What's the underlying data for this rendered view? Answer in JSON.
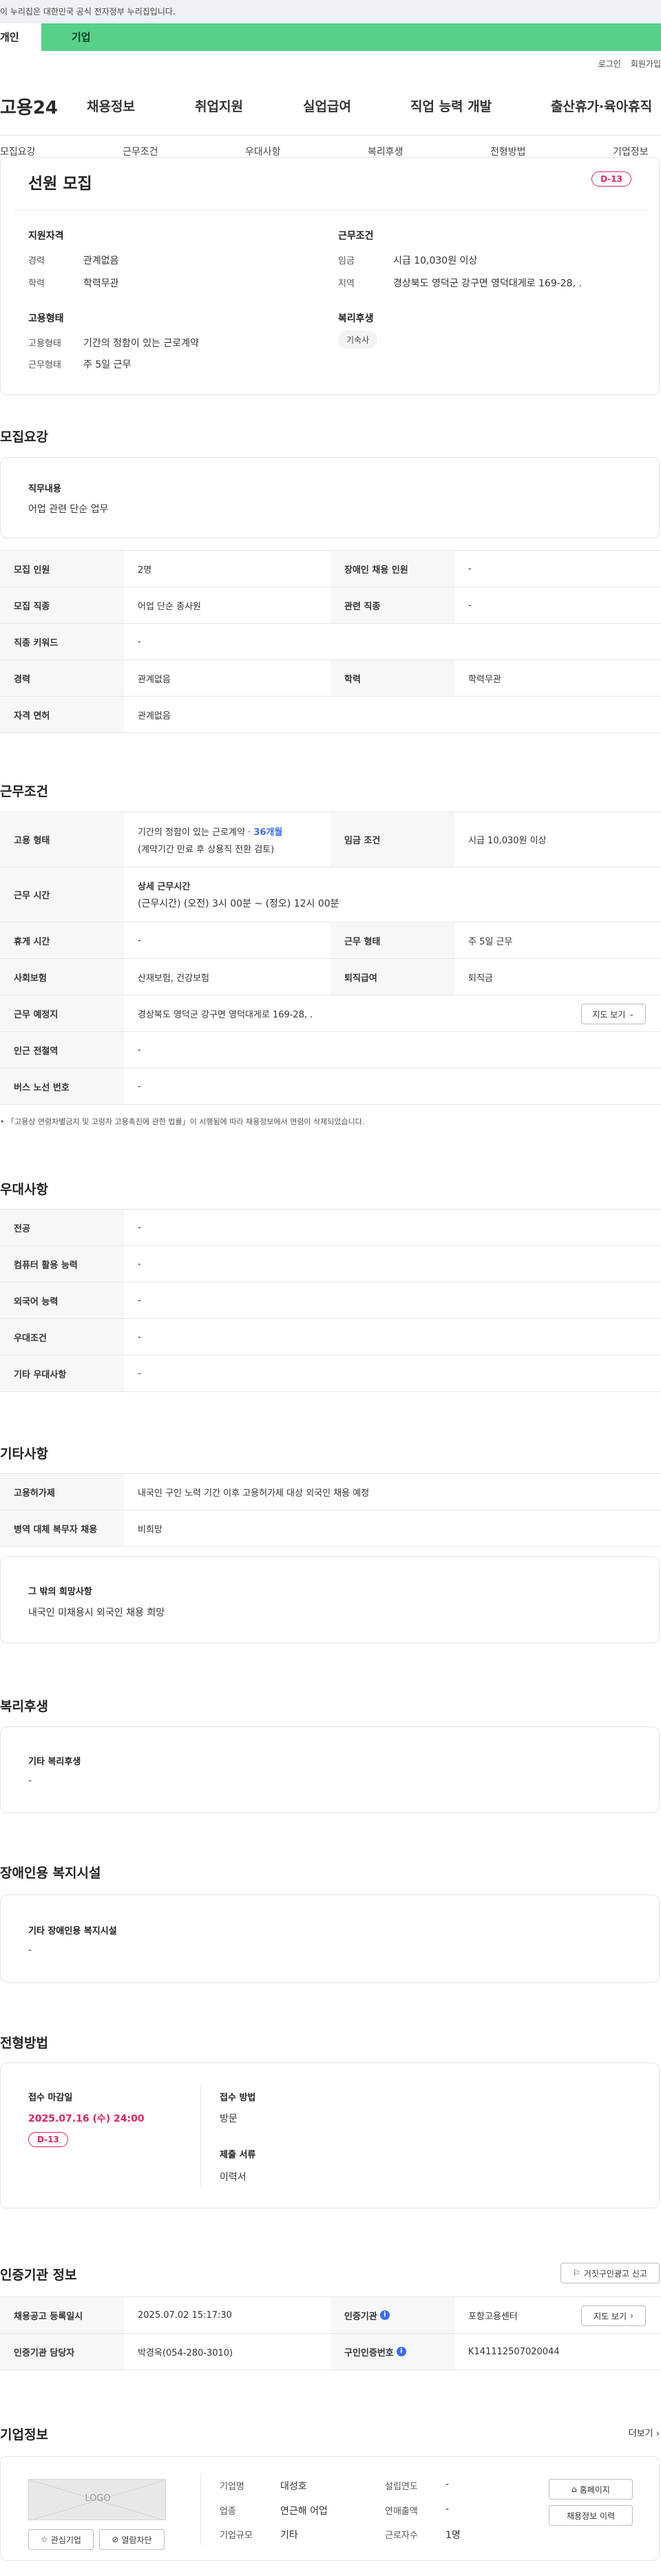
{
  "header": {
    "gov_notice": "이 누리집은 대한민국 공식 전자정부 누리집입니다.",
    "tabs": [
      "개인",
      "기업"
    ],
    "util_links": [
      "로그인",
      "회원가입"
    ],
    "logo": "고용24",
    "gnb": [
      "채용정보",
      "취업지원",
      "실업급여",
      "직업 능력 개발",
      "출산휴가·육아휴직"
    ]
  },
  "subnav": [
    "모집요강",
    "근무조건",
    "우대사항",
    "복리후생",
    "전형방법",
    "기업정보"
  ],
  "summary": {
    "title": "선원 모집",
    "dday": "D-13",
    "qual_heading": "지원자격",
    "career_label": "경력",
    "career": "관계없음",
    "edu_label": "학력",
    "edu": "학력무관",
    "emp_heading": "고용형태",
    "emp_type_label": "고용형태",
    "emp_type": "기간의 정함이 있는 근로계약",
    "work_form_label": "근무형태",
    "work_form": "주 5일 근무",
    "cond_heading": "근무조건",
    "wage_label": "임금",
    "wage": "시급 10,030원 이상",
    "region_label": "지역",
    "region": "경상북도 영덕군 강구면 영덕대게로 169-28, .",
    "welfare_heading": "복리후생",
    "welfare_tag": "기숙사"
  },
  "recruit": {
    "heading": "모집요강",
    "job_desc_title": "직무내용",
    "job_desc": "어업 관련 단순 업무",
    "rows": {
      "headcount_label": "모집 인원",
      "headcount": "2명",
      "disabled_label": "장애인 채용 인원",
      "disabled": "-",
      "job_label": "모집 직종",
      "job": "어업 단순 종사원",
      "related_label": "관련 직종",
      "related": "-",
      "keyword_label": "직종 키워드",
      "keyword": "-",
      "career_label": "경력",
      "career": "관계없음",
      "edu_label": "학력",
      "edu": "학력무관",
      "license_label": "자격 면허",
      "license": "관계없음"
    }
  },
  "conditions": {
    "heading": "근무조건",
    "emp_type_label": "고용 형태",
    "emp_type_prefix": "기간의 정함이 있는 근로계약 ·",
    "emp_type_months": "36개월",
    "emp_type_note": "(계약기간 만료 후 상용직 전환 검토)",
    "wage_label": "임금 조건",
    "wage": "시급 10,030원 이상",
    "hours_label": "근무 시간",
    "hours_title": "상세 근무시간",
    "hours_detail": "(근무시간) (오전) 3시 00분 ~ (정오) 12시 00분",
    "break_label": "휴게 시간",
    "break": "-",
    "form_label": "근무 형태",
    "form": "주 5일 근무",
    "insurance_label": "사회보험",
    "insurance": "산재보험, 건강보험",
    "retire_label": "퇴직급여",
    "retire": "퇴직금",
    "place_label": "근무 예정지",
    "place": "경상북도 영덕군 강구면 영덕대게로 169-28, .",
    "map_button": "지도 보기",
    "station_label": "인근 전철역",
    "station": "-",
    "bus_label": "버스 노선 번호",
    "bus": "-",
    "footnote": "「고용상 연령차별금지 및 고령자 고용촉진에 관한 법률」이 시행됨에 따라 채용정보에서 연령이 삭제되었습니다."
  },
  "preference": {
    "heading": "우대사항",
    "major_label": "전공",
    "major": "-",
    "pc_label": "컴퓨터 활용 능력",
    "pc": "-",
    "lang_label": "외국어 능력",
    "lang": "-",
    "pref_label": "우대조건",
    "pref": "-",
    "other_label": "기타 우대사항",
    "other": "-"
  },
  "etc": {
    "heading": "기타사항",
    "permit_label": "고용허가제",
    "permit": "내국인 구인 노력 기간 이후 고용허가제 대상 외국인 채용 예정",
    "military_label": "병역 대체 복무자 채용",
    "military": "비희망",
    "wish_title": "그 밖의 희망사항",
    "wish": "내국인 미채용시 외국인 채용 희망"
  },
  "welfare": {
    "heading": "복리후생",
    "box_title": "기타 복리후생",
    "box_value": "-"
  },
  "disability": {
    "heading": "장애인용 복지시설",
    "box_title": "기타 장애인용 복지시설",
    "box_value": "-"
  },
  "process": {
    "heading": "전형방법",
    "deadline_label": "접수 마감일",
    "deadline": "2025.07.16 (수) 24:00",
    "dday": "D-13",
    "method_label": "접수 방법",
    "method": "방문",
    "docs_label": "제출 서류",
    "docs": "이력서"
  },
  "agency": {
    "heading": "인증기관 정보",
    "report_button": "거짓구인광고 신고",
    "reg_label": "채용공고 등록일시",
    "reg": "2025.07.02 15:17:30",
    "org_label": "인증기관",
    "org": "포항고용센터",
    "map_button": "지도 보기",
    "manager_label": "인증기관 담당자",
    "manager": "박경옥(054-280-3010)",
    "cert_label": "구인인증번호",
    "cert": "K141112507020044"
  },
  "company": {
    "heading": "기업정보",
    "more": "더보기",
    "logo_text": "LOGO",
    "fav_button": "관심기업",
    "block_button": "열람차단",
    "name_label": "기업명",
    "name": "대성호",
    "industry_label": "업종",
    "industry": "연근해 어업",
    "size_label": "기업규모",
    "size": "기타",
    "founded_label": "설립연도",
    "founded": "-",
    "sales_label": "연매출액",
    "sales": "-",
    "staff_label": "근로자수",
    "staff": "1명",
    "home_button": "홈페이지",
    "jobs_button": "채용정보 이력"
  },
  "colors": {
    "tab_green": "#57d08a",
    "dday_red": "#e0245e",
    "link_blue": "#3a6df0"
  }
}
